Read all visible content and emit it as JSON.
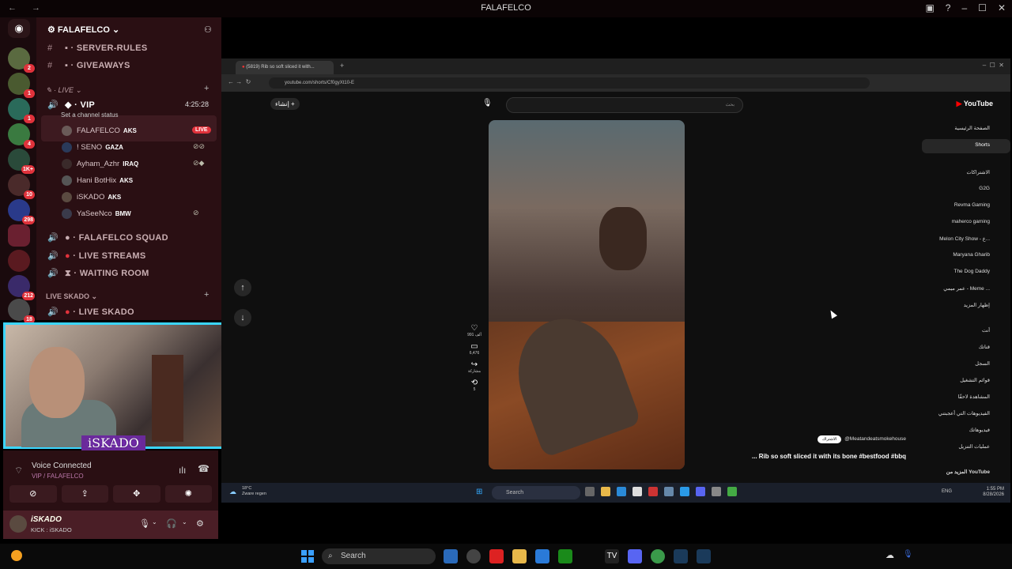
{
  "window": {
    "title": "FALAFELCO"
  },
  "servers": [
    {
      "badge": ""
    },
    {
      "badge": "2"
    },
    {
      "badge": "1"
    },
    {
      "badge": "1"
    },
    {
      "badge": "4"
    },
    {
      "badge": "1K+"
    },
    {
      "badge": "10"
    },
    {
      "badge": "298"
    },
    {
      "badge": ""
    },
    {
      "badge": ""
    },
    {
      "badge": "212"
    },
    {
      "badge": "18"
    }
  ],
  "server": {
    "name": "FALAFELCO"
  },
  "channels": {
    "rules": "SERVER-RULES",
    "giveaways": "GIVEAWAYS",
    "live_category": "LIVE",
    "vip": "VIP",
    "vip_timer": "4:25:28",
    "vip_status": "Set a channel status",
    "squad": "FALAFELCO SQUAD",
    "live_streams": "LIVE STREAMS",
    "waiting_room": "WAITING ROOM",
    "live_skado_category": "LIVE SKADO",
    "live_skado": "LIVE SKADO"
  },
  "voice_users": [
    {
      "name": "FALAFELCO",
      "tag": "AKS"
    },
    {
      "name": "! SENO",
      "tag": "GAZA"
    },
    {
      "name": "Ayham_Azhr",
      "tag": "IRAQ"
    },
    {
      "name": "Hani BotHix",
      "tag": "AKS"
    },
    {
      "name": "iSKADO",
      "tag": "AKS"
    },
    {
      "name": "YaSeeNco",
      "tag": "BMW"
    }
  ],
  "live_label": "LIVE",
  "webcam": {
    "name": "iSKADO"
  },
  "voice": {
    "title": "Voice Connected",
    "sub": "VIP / FALAFELCO"
  },
  "user": {
    "name": "iSKADO",
    "sub": "KICK : iSKADO"
  },
  "browser": {
    "tab_title": "(5819) Rib so soft sliced it with...",
    "url": "youtube.com/shorts/Cf0gyXt10-E",
    "search_placeholder": "بحث",
    "create_label": "إنشاء"
  },
  "short": {
    "likes": "991 ألف",
    "comments": "6,476",
    "share": "مشاركة",
    "remix": "5",
    "channel": "@Meatandeatsmokehouse",
    "subscribe": "الاشتراك",
    "caption": "... Rib so soft sliced it with its bone #bestfood #bbq"
  },
  "yt_sidebar": {
    "logo": "YouTube",
    "home": "الصفحة الرئيسية",
    "shorts": "Shorts",
    "subs_header": "الاشتراكات",
    "subs": [
      "G2G",
      "Revma Gaming",
      "maherco gaming",
      "Melon City Show - ع...",
      "Maryana Gharib",
      "The Dog Daddy",
      "عمر ميمي - Meme ...",
      "إظهار المزيد"
    ],
    "you_header": "أنت",
    "you": [
      "قناتك",
      "السجل",
      "قوائم التشغيل",
      "المشاهدة لاحقًا",
      "الفيديوهات التي أعجبتني",
      "فيديوهاتك",
      "عمليات التنزيل"
    ],
    "more_from": "المزيد من YouTube"
  },
  "remote_taskbar": {
    "weather_temp": "18°C",
    "weather_desc": "Zware regen",
    "search": "Search",
    "lang": "ENG",
    "time": "1:55 PM",
    "date": "8/28/2026"
  },
  "taskbar": {
    "search": "Search"
  },
  "colors": {
    "accent": "#3ad6ff",
    "discord_bg": "#2a0f13",
    "live": "#e0323b",
    "yt_red": "#ff0000"
  }
}
